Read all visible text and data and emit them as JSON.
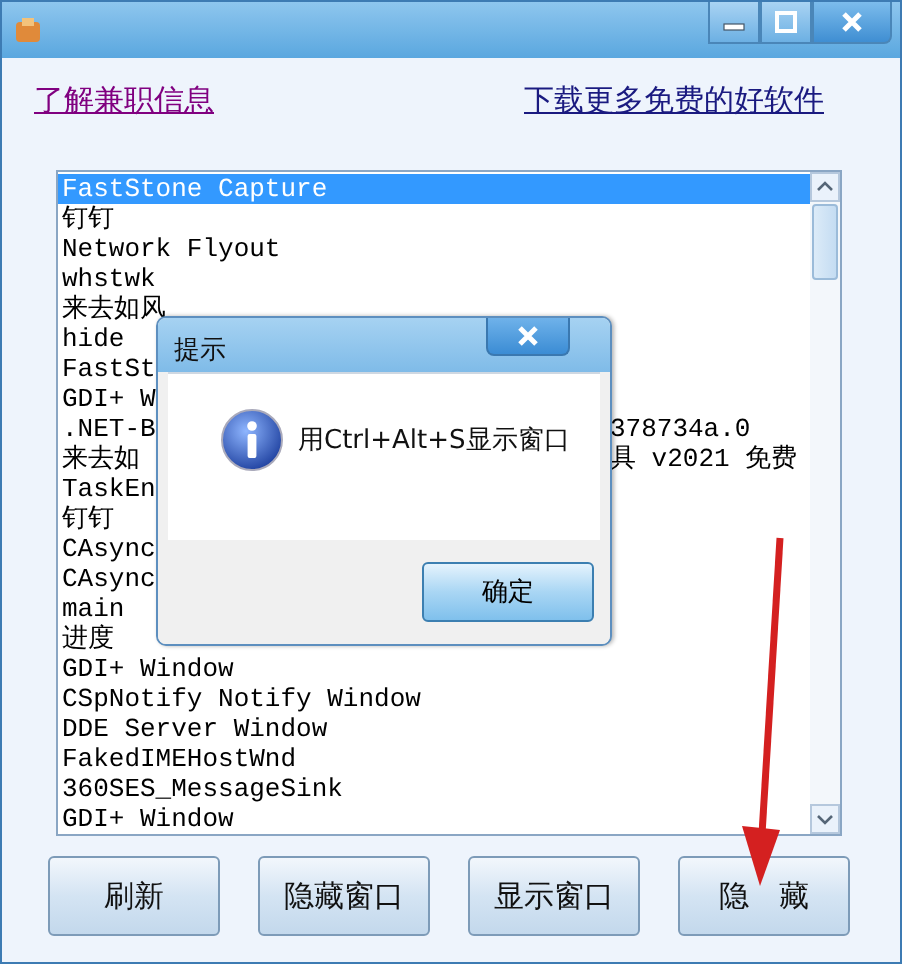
{
  "links": [
    {
      "label": "了解兼职信息",
      "visited": true
    },
    {
      "label": "下载更多免费的好软件",
      "visited": false
    }
  ],
  "list": {
    "rows": [
      {
        "text": "FastStone Capture",
        "selected": true
      },
      {
        "text": "钉钉",
        "selected": false
      },
      {
        "text": "Network Flyout",
        "selected": false
      },
      {
        "text": "whstwk",
        "selected": false
      },
      {
        "text": "来去如风",
        "selected": false
      },
      {
        "text": "hide",
        "selected": false
      },
      {
        "text": "FastSt",
        "selected": false
      },
      {
        "text": "GDI+ W",
        "selected": false
      },
      {
        "text": ".NET-B",
        "tail": "378734a.0",
        "selected": false
      },
      {
        "text": "来去如",
        "tail": "具 v2021 免费",
        "selected": false
      },
      {
        "text": "TaskEn",
        "selected": false
      },
      {
        "text": "钉钉",
        "selected": false
      },
      {
        "text": "CAsync",
        "selected": false
      },
      {
        "text": "CAsync",
        "selected": false
      },
      {
        "text": "main",
        "selected": false
      },
      {
        "text": "进度",
        "selected": false
      },
      {
        "text": "GDI+ Window",
        "selected": false
      },
      {
        "text": "CSpNotify Notify Window",
        "selected": false
      },
      {
        "text": "DDE Server Window",
        "selected": false
      },
      {
        "text": "FakedIMEHostWnd",
        "selected": false
      },
      {
        "text": "360SES_MessageSink",
        "selected": false
      },
      {
        "text": "GDI+ Window",
        "selected": false
      }
    ]
  },
  "dialog": {
    "title": "提示",
    "message": "用Ctrl+Alt+S显示窗口",
    "button": "确定"
  },
  "buttons": [
    "刷新",
    "隐藏窗口",
    "显示窗口",
    "隐　藏"
  ],
  "annotation": {
    "kind": "arrow"
  }
}
